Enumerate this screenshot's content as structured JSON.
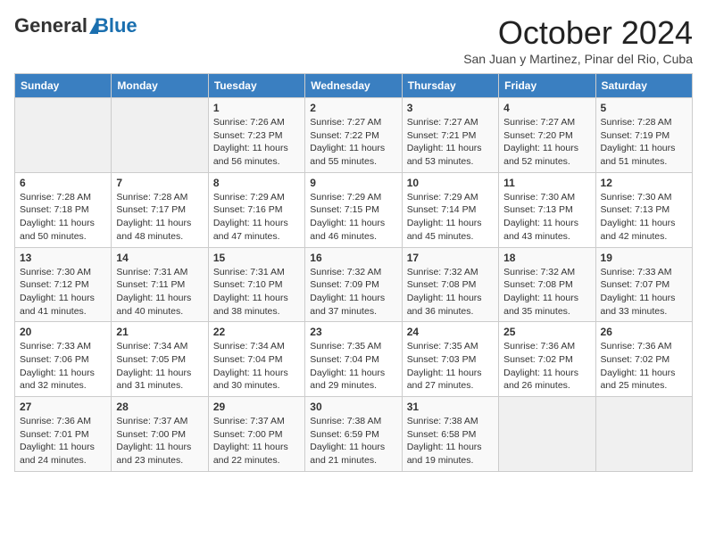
{
  "header": {
    "logo_general": "General",
    "logo_blue": "Blue",
    "month_title": "October 2024",
    "subtitle": "San Juan y Martinez, Pinar del Rio, Cuba"
  },
  "days_of_week": [
    "Sunday",
    "Monday",
    "Tuesday",
    "Wednesday",
    "Thursday",
    "Friday",
    "Saturday"
  ],
  "weeks": [
    [
      {
        "day": "",
        "info": ""
      },
      {
        "day": "",
        "info": ""
      },
      {
        "day": "1",
        "info": "Sunrise: 7:26 AM\nSunset: 7:23 PM\nDaylight: 11 hours and 56 minutes."
      },
      {
        "day": "2",
        "info": "Sunrise: 7:27 AM\nSunset: 7:22 PM\nDaylight: 11 hours and 55 minutes."
      },
      {
        "day": "3",
        "info": "Sunrise: 7:27 AM\nSunset: 7:21 PM\nDaylight: 11 hours and 53 minutes."
      },
      {
        "day": "4",
        "info": "Sunrise: 7:27 AM\nSunset: 7:20 PM\nDaylight: 11 hours and 52 minutes."
      },
      {
        "day": "5",
        "info": "Sunrise: 7:28 AM\nSunset: 7:19 PM\nDaylight: 11 hours and 51 minutes."
      }
    ],
    [
      {
        "day": "6",
        "info": "Sunrise: 7:28 AM\nSunset: 7:18 PM\nDaylight: 11 hours and 50 minutes."
      },
      {
        "day": "7",
        "info": "Sunrise: 7:28 AM\nSunset: 7:17 PM\nDaylight: 11 hours and 48 minutes."
      },
      {
        "day": "8",
        "info": "Sunrise: 7:29 AM\nSunset: 7:16 PM\nDaylight: 11 hours and 47 minutes."
      },
      {
        "day": "9",
        "info": "Sunrise: 7:29 AM\nSunset: 7:15 PM\nDaylight: 11 hours and 46 minutes."
      },
      {
        "day": "10",
        "info": "Sunrise: 7:29 AM\nSunset: 7:14 PM\nDaylight: 11 hours and 45 minutes."
      },
      {
        "day": "11",
        "info": "Sunrise: 7:30 AM\nSunset: 7:13 PM\nDaylight: 11 hours and 43 minutes."
      },
      {
        "day": "12",
        "info": "Sunrise: 7:30 AM\nSunset: 7:13 PM\nDaylight: 11 hours and 42 minutes."
      }
    ],
    [
      {
        "day": "13",
        "info": "Sunrise: 7:30 AM\nSunset: 7:12 PM\nDaylight: 11 hours and 41 minutes."
      },
      {
        "day": "14",
        "info": "Sunrise: 7:31 AM\nSunset: 7:11 PM\nDaylight: 11 hours and 40 minutes."
      },
      {
        "day": "15",
        "info": "Sunrise: 7:31 AM\nSunset: 7:10 PM\nDaylight: 11 hours and 38 minutes."
      },
      {
        "day": "16",
        "info": "Sunrise: 7:32 AM\nSunset: 7:09 PM\nDaylight: 11 hours and 37 minutes."
      },
      {
        "day": "17",
        "info": "Sunrise: 7:32 AM\nSunset: 7:08 PM\nDaylight: 11 hours and 36 minutes."
      },
      {
        "day": "18",
        "info": "Sunrise: 7:32 AM\nSunset: 7:08 PM\nDaylight: 11 hours and 35 minutes."
      },
      {
        "day": "19",
        "info": "Sunrise: 7:33 AM\nSunset: 7:07 PM\nDaylight: 11 hours and 33 minutes."
      }
    ],
    [
      {
        "day": "20",
        "info": "Sunrise: 7:33 AM\nSunset: 7:06 PM\nDaylight: 11 hours and 32 minutes."
      },
      {
        "day": "21",
        "info": "Sunrise: 7:34 AM\nSunset: 7:05 PM\nDaylight: 11 hours and 31 minutes."
      },
      {
        "day": "22",
        "info": "Sunrise: 7:34 AM\nSunset: 7:04 PM\nDaylight: 11 hours and 30 minutes."
      },
      {
        "day": "23",
        "info": "Sunrise: 7:35 AM\nSunset: 7:04 PM\nDaylight: 11 hours and 29 minutes."
      },
      {
        "day": "24",
        "info": "Sunrise: 7:35 AM\nSunset: 7:03 PM\nDaylight: 11 hours and 27 minutes."
      },
      {
        "day": "25",
        "info": "Sunrise: 7:36 AM\nSunset: 7:02 PM\nDaylight: 11 hours and 26 minutes."
      },
      {
        "day": "26",
        "info": "Sunrise: 7:36 AM\nSunset: 7:02 PM\nDaylight: 11 hours and 25 minutes."
      }
    ],
    [
      {
        "day": "27",
        "info": "Sunrise: 7:36 AM\nSunset: 7:01 PM\nDaylight: 11 hours and 24 minutes."
      },
      {
        "day": "28",
        "info": "Sunrise: 7:37 AM\nSunset: 7:00 PM\nDaylight: 11 hours and 23 minutes."
      },
      {
        "day": "29",
        "info": "Sunrise: 7:37 AM\nSunset: 7:00 PM\nDaylight: 11 hours and 22 minutes."
      },
      {
        "day": "30",
        "info": "Sunrise: 7:38 AM\nSunset: 6:59 PM\nDaylight: 11 hours and 21 minutes."
      },
      {
        "day": "31",
        "info": "Sunrise: 7:38 AM\nSunset: 6:58 PM\nDaylight: 11 hours and 19 minutes."
      },
      {
        "day": "",
        "info": ""
      },
      {
        "day": "",
        "info": ""
      }
    ]
  ]
}
